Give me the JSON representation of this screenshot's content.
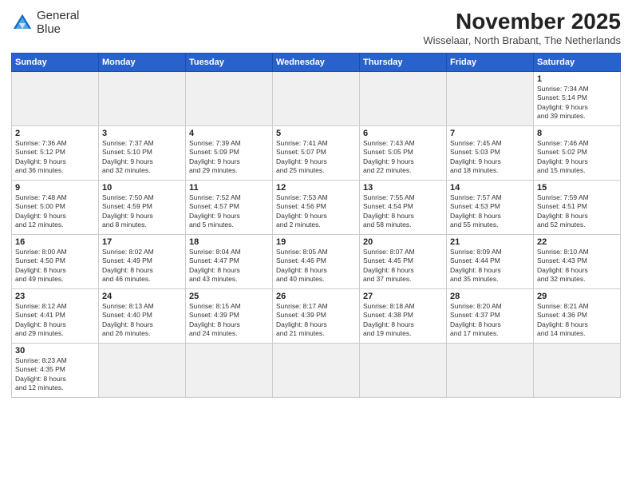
{
  "header": {
    "logo_line1": "General",
    "logo_line2": "Blue",
    "month_title": "November 2025",
    "subtitle": "Wisselaar, North Brabant, The Netherlands"
  },
  "weekdays": [
    "Sunday",
    "Monday",
    "Tuesday",
    "Wednesday",
    "Thursday",
    "Friday",
    "Saturday"
  ],
  "weeks": [
    [
      {
        "day": "",
        "info": ""
      },
      {
        "day": "",
        "info": ""
      },
      {
        "day": "",
        "info": ""
      },
      {
        "day": "",
        "info": ""
      },
      {
        "day": "",
        "info": ""
      },
      {
        "day": "",
        "info": ""
      },
      {
        "day": "1",
        "info": "Sunrise: 7:34 AM\nSunset: 5:14 PM\nDaylight: 9 hours\nand 39 minutes."
      }
    ],
    [
      {
        "day": "2",
        "info": "Sunrise: 7:36 AM\nSunset: 5:12 PM\nDaylight: 9 hours\nand 36 minutes."
      },
      {
        "day": "3",
        "info": "Sunrise: 7:37 AM\nSunset: 5:10 PM\nDaylight: 9 hours\nand 32 minutes."
      },
      {
        "day": "4",
        "info": "Sunrise: 7:39 AM\nSunset: 5:09 PM\nDaylight: 9 hours\nand 29 minutes."
      },
      {
        "day": "5",
        "info": "Sunrise: 7:41 AM\nSunset: 5:07 PM\nDaylight: 9 hours\nand 25 minutes."
      },
      {
        "day": "6",
        "info": "Sunrise: 7:43 AM\nSunset: 5:05 PM\nDaylight: 9 hours\nand 22 minutes."
      },
      {
        "day": "7",
        "info": "Sunrise: 7:45 AM\nSunset: 5:03 PM\nDaylight: 9 hours\nand 18 minutes."
      },
      {
        "day": "8",
        "info": "Sunrise: 7:46 AM\nSunset: 5:02 PM\nDaylight: 9 hours\nand 15 minutes."
      }
    ],
    [
      {
        "day": "9",
        "info": "Sunrise: 7:48 AM\nSunset: 5:00 PM\nDaylight: 9 hours\nand 12 minutes."
      },
      {
        "day": "10",
        "info": "Sunrise: 7:50 AM\nSunset: 4:59 PM\nDaylight: 9 hours\nand 8 minutes."
      },
      {
        "day": "11",
        "info": "Sunrise: 7:52 AM\nSunset: 4:57 PM\nDaylight: 9 hours\nand 5 minutes."
      },
      {
        "day": "12",
        "info": "Sunrise: 7:53 AM\nSunset: 4:56 PM\nDaylight: 9 hours\nand 2 minutes."
      },
      {
        "day": "13",
        "info": "Sunrise: 7:55 AM\nSunset: 4:54 PM\nDaylight: 8 hours\nand 58 minutes."
      },
      {
        "day": "14",
        "info": "Sunrise: 7:57 AM\nSunset: 4:53 PM\nDaylight: 8 hours\nand 55 minutes."
      },
      {
        "day": "15",
        "info": "Sunrise: 7:59 AM\nSunset: 4:51 PM\nDaylight: 8 hours\nand 52 minutes."
      }
    ],
    [
      {
        "day": "16",
        "info": "Sunrise: 8:00 AM\nSunset: 4:50 PM\nDaylight: 8 hours\nand 49 minutes."
      },
      {
        "day": "17",
        "info": "Sunrise: 8:02 AM\nSunset: 4:49 PM\nDaylight: 8 hours\nand 46 minutes."
      },
      {
        "day": "18",
        "info": "Sunrise: 8:04 AM\nSunset: 4:47 PM\nDaylight: 8 hours\nand 43 minutes."
      },
      {
        "day": "19",
        "info": "Sunrise: 8:05 AM\nSunset: 4:46 PM\nDaylight: 8 hours\nand 40 minutes."
      },
      {
        "day": "20",
        "info": "Sunrise: 8:07 AM\nSunset: 4:45 PM\nDaylight: 8 hours\nand 37 minutes."
      },
      {
        "day": "21",
        "info": "Sunrise: 8:09 AM\nSunset: 4:44 PM\nDaylight: 8 hours\nand 35 minutes."
      },
      {
        "day": "22",
        "info": "Sunrise: 8:10 AM\nSunset: 4:43 PM\nDaylight: 8 hours\nand 32 minutes."
      }
    ],
    [
      {
        "day": "23",
        "info": "Sunrise: 8:12 AM\nSunset: 4:41 PM\nDaylight: 8 hours\nand 29 minutes."
      },
      {
        "day": "24",
        "info": "Sunrise: 8:13 AM\nSunset: 4:40 PM\nDaylight: 8 hours\nand 26 minutes."
      },
      {
        "day": "25",
        "info": "Sunrise: 8:15 AM\nSunset: 4:39 PM\nDaylight: 8 hours\nand 24 minutes."
      },
      {
        "day": "26",
        "info": "Sunrise: 8:17 AM\nSunset: 4:39 PM\nDaylight: 8 hours\nand 21 minutes."
      },
      {
        "day": "27",
        "info": "Sunrise: 8:18 AM\nSunset: 4:38 PM\nDaylight: 8 hours\nand 19 minutes."
      },
      {
        "day": "28",
        "info": "Sunrise: 8:20 AM\nSunset: 4:37 PM\nDaylight: 8 hours\nand 17 minutes."
      },
      {
        "day": "29",
        "info": "Sunrise: 8:21 AM\nSunset: 4:36 PM\nDaylight: 8 hours\nand 14 minutes."
      }
    ],
    [
      {
        "day": "30",
        "info": "Sunrise: 8:23 AM\nSunset: 4:35 PM\nDaylight: 8 hours\nand 12 minutes."
      },
      {
        "day": "",
        "info": ""
      },
      {
        "day": "",
        "info": ""
      },
      {
        "day": "",
        "info": ""
      },
      {
        "day": "",
        "info": ""
      },
      {
        "day": "",
        "info": ""
      },
      {
        "day": "",
        "info": ""
      }
    ]
  ]
}
